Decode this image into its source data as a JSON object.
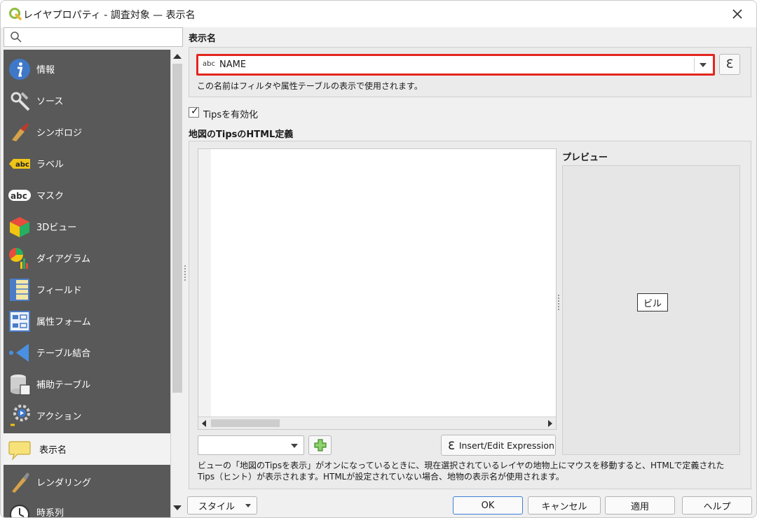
{
  "window": {
    "title": "レイヤプロパティ - 調査対象 — 表示名",
    "close_icon": "close-icon"
  },
  "search": {
    "placeholder": "",
    "value": "",
    "icon": "search-icon"
  },
  "sidebar": {
    "items": [
      {
        "label": "情報",
        "icon": "info-icon"
      },
      {
        "label": "ソース",
        "icon": "source-icon"
      },
      {
        "label": "シンボロジ",
        "icon": "symbology-icon"
      },
      {
        "label": "ラベル",
        "icon": "labels-icon"
      },
      {
        "label": "マスク",
        "icon": "mask-icon"
      },
      {
        "label": "3Dビュー",
        "icon": "3d-view-icon"
      },
      {
        "label": "ダイアグラム",
        "icon": "diagram-icon"
      },
      {
        "label": "フィールド",
        "icon": "fields-icon"
      },
      {
        "label": "属性フォーム",
        "icon": "attributes-form-icon"
      },
      {
        "label": "テーブル結合",
        "icon": "joins-icon"
      },
      {
        "label": "補助テーブル",
        "icon": "auxiliary-storage-icon"
      },
      {
        "label": "アクション",
        "icon": "actions-icon"
      },
      {
        "label": "表示名",
        "icon": "display-icon"
      },
      {
        "label": "レンダリング",
        "icon": "rendering-icon"
      },
      {
        "label": "時系列",
        "icon": "temporal-icon"
      }
    ],
    "active_index": 12
  },
  "main": {
    "display_name_header": "表示名",
    "display_field": {
      "type_badge": "abc",
      "value": "NAME"
    },
    "display_field_hint": "この名前はフィルタや属性テーブルの表示で使用されます。",
    "tips_checkbox_label": "Tipsを有効化",
    "tips_checked": true,
    "html_header": "地図のTipsのHTML定義",
    "preview_label": "プレビュー",
    "preview_value": "ビル",
    "insert_button_label": "Insert/Edit Expression",
    "info_text": "ビューの「地図のTipsを表示」がオンになっているときに、現在選択されているレイヤの地物上にマウスを移動すると、HTMLで定義されたTips（ヒント）が表示されます。HTMLが設定されていない場合、地物の表示名が使用されます。"
  },
  "footer": {
    "style_label": "スタイル",
    "ok_label": "OK",
    "cancel_label": "キャンセル",
    "apply_label": "適用",
    "help_label": "ヘルプ"
  },
  "colors": {
    "sidebar_bg": "#595959",
    "highlight_border": "#e3261f",
    "ok_border": "#3d7fd6"
  }
}
